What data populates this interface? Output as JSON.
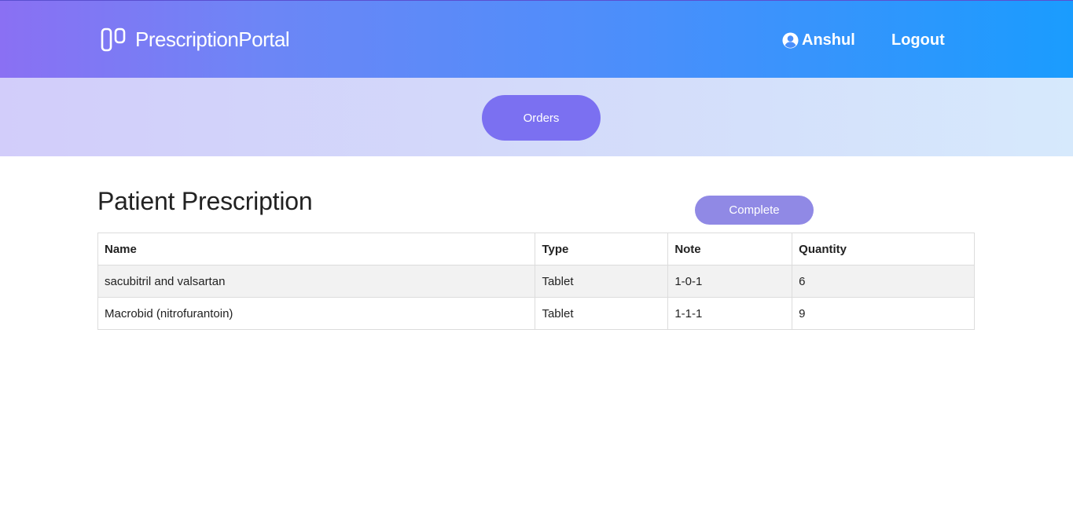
{
  "header": {
    "brand_name": "PrescriptionPortal",
    "brand_icon": "columns-icon",
    "user_name": "Anshul",
    "user_icon": "user-circle-icon",
    "logout_label": "Logout"
  },
  "subnav": {
    "orders_label": "Orders"
  },
  "main": {
    "title": "Patient Prescription",
    "complete_label": "Complete",
    "table": {
      "columns": [
        "Name",
        "Type",
        "Note",
        "Quantity"
      ],
      "rows": [
        [
          "sacubitril and valsartan",
          "Tablet",
          "1-0-1",
          "6"
        ],
        [
          "Macrobid (nitrofurantoin)",
          "Tablet",
          "1-1-1",
          "9"
        ]
      ]
    }
  },
  "colors": {
    "header_gradient_start": "#8a70f3",
    "header_gradient_end": "#1a9cfe",
    "orders_button": "#7b70f1",
    "complete_button": "#9089e5",
    "row_stripe": "#f2f2f2"
  }
}
